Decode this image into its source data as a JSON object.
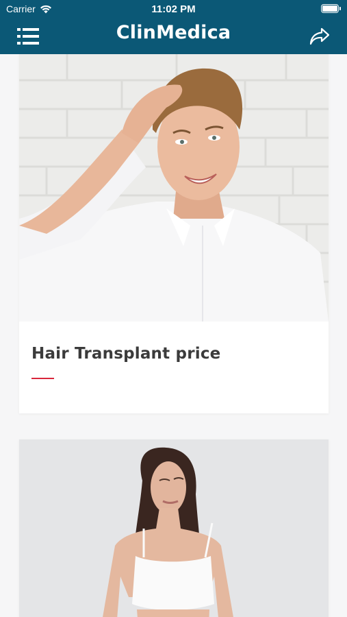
{
  "status_bar": {
    "carrier": "Carrier",
    "time": "11:02 PM",
    "wifi_icon": "wifi-icon",
    "battery_icon": "battery-icon"
  },
  "header": {
    "title": "ClinMedica",
    "menu_icon": "menu-icon",
    "share_icon": "share-icon",
    "background_color": "#0b5876"
  },
  "feed": {
    "cards": [
      {
        "caption": "Hair Transplant price",
        "image": "man-hair-photo",
        "accent_color": "#d9263b"
      },
      {
        "caption": "",
        "image": "woman-body-photo"
      }
    ]
  }
}
